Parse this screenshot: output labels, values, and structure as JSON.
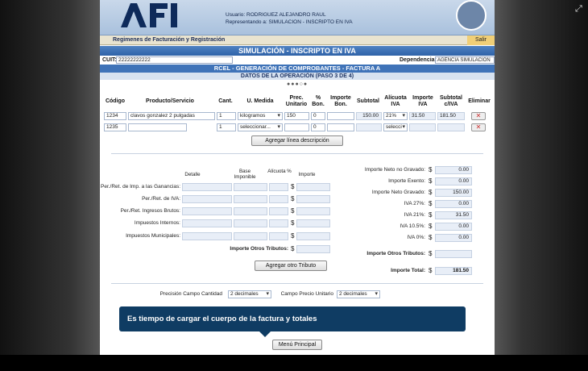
{
  "header": {
    "user_line": "Usuario: RODRIGUEZ ALEJANDRO RAUL",
    "rep_line": "Representando a: SIMULACION - INSCRIPTO EN IVA"
  },
  "menu": {
    "item": "Regimenes de Facturación y Registración",
    "salir": "Salir"
  },
  "banner": "SIMULACIÓN - INSCRIPTO EN IVA",
  "cuit": {
    "label": "CUIT:",
    "value": "22222222222",
    "dep_label": "Dependencia:",
    "dep_value": "AGENCIA SIMULACION"
  },
  "rcel_title": "RCEL - GENERACIÓN DE COMPROBANTES - FACTURA A",
  "step_title": "DATOS DE LA OPERACIÓN (PASO 3 DE 4)",
  "step_dots": "●●●○●",
  "columns": {
    "codigo": "Código",
    "producto": "Producto/Servicio",
    "cant": "Cant.",
    "umedida": "U. Medida",
    "prec": "Prec. Unitario",
    "bon": "% Bon.",
    "impbon": "Importe Bon.",
    "subtotal": "Subtotal",
    "alicuota": "Alícuota IVA",
    "impiva": "Importe IVA",
    "subtotaliva": "Subtotal c/IVA",
    "eliminar": "Eliminar"
  },
  "rows": [
    {
      "codigo": "1234",
      "producto": "clavos gonzalez 2 pulgadas",
      "cant": "1",
      "umedida": "kilogramos",
      "prec": "150",
      "bon": "0",
      "impbon": "",
      "subtotal": "150.00",
      "alicuota": "21%",
      "impiva": "31.50",
      "subtotaliva": "181.50",
      "del": "✕"
    },
    {
      "codigo": "1235",
      "producto": "",
      "cant": "1",
      "umedida": "seleccionar...",
      "prec": "",
      "bon": "0",
      "impbon": "",
      "subtotal": "",
      "alicuota": "selecci",
      "impiva": "",
      "subtotaliva": "",
      "del": "✕"
    }
  ],
  "agregar_linea": "Agregar línea descripción",
  "tributos": {
    "headers": {
      "detalle": "Detalle",
      "base": "Base Imponible",
      "alicuota": "Alícuota %",
      "importe": "Importe"
    },
    "labels": [
      "Per./Ret. de Imp. a las Ganancias:",
      "Per./Ret. de IVA:",
      "Per./Ret. Ingresos Brutos:",
      "Impuestos Internos:",
      "Impuestos Municipales:"
    ],
    "otros_label": "Importe Otros Tributos:",
    "agregar": "Agregar otro Tributo"
  },
  "totals": [
    {
      "label": "Importe Neto no Gravado:",
      "value": "0.00"
    },
    {
      "label": "Importe Exento:",
      "value": "0.00"
    },
    {
      "label": "Importe Neto Gravado:",
      "value": "150.00"
    },
    {
      "label": "IVA 27%:",
      "value": "0.00"
    },
    {
      "label": "IVA 21%:",
      "value": "31.50"
    },
    {
      "label": "IVA 10.5%:",
      "value": "0.00"
    },
    {
      "label": "IVA 0%:",
      "value": "0.00"
    }
  ],
  "otros_tributos_total": {
    "label": "Importe Otros Tributos:",
    "value": ""
  },
  "importe_total": {
    "label": "Importe Total:",
    "value": "181.50"
  },
  "currency": "$",
  "precision": {
    "cantidad_label": "Precisión Campo Cantidad",
    "cantidad_value": "2 decimales",
    "precio_label": "Campo Precio Unitario",
    "precio_value": "2 decimales"
  },
  "tooltip": "Es tiempo de cargar el cuerpo de la factura y totales",
  "menu_principal": "Menú Principal",
  "window_corner": "⤢"
}
